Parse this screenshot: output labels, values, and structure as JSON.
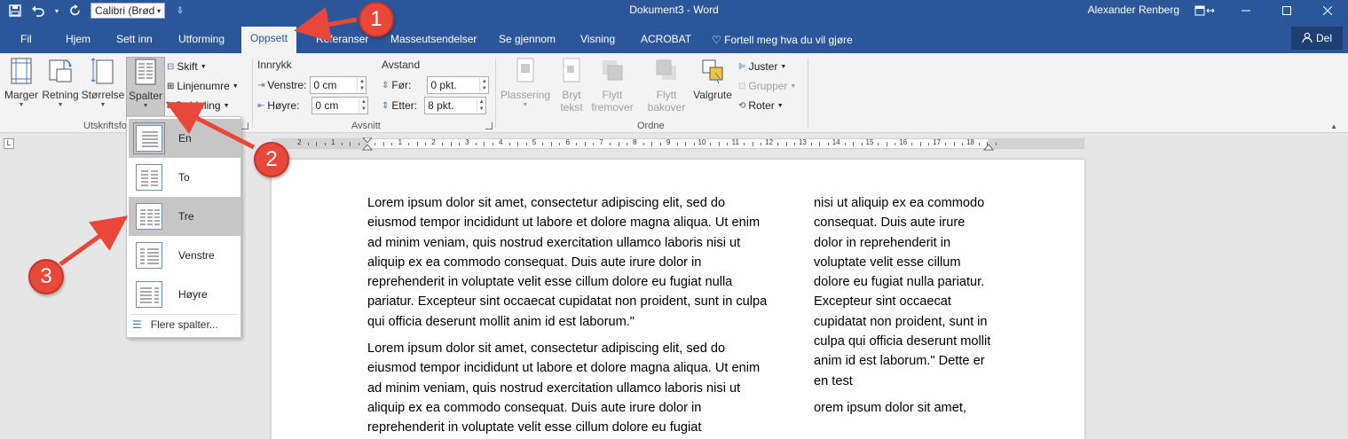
{
  "titlebar": {
    "font_name": "Calibri (Brød",
    "doc_title": "Dokument3 - Word",
    "user": "Alexander Renberg"
  },
  "tabs": [
    {
      "label": "Fil"
    },
    {
      "label": "Hjem"
    },
    {
      "label": "Sett inn"
    },
    {
      "label": "Utforming"
    },
    {
      "label": "Oppsett",
      "active": true
    },
    {
      "label": "Referanser"
    },
    {
      "label": "Masseutsendelser"
    },
    {
      "label": "Se gjennom"
    },
    {
      "label": "Visning"
    },
    {
      "label": "ACROBAT"
    }
  ],
  "tell_me": "Fortell meg hva du vil gjøre",
  "share": "Del",
  "ribbon": {
    "page_setup": {
      "margins": "Marger",
      "orientation": "Retning",
      "size": "Størrelse",
      "columns": "Spalter",
      "breaks": "Skift",
      "line_numbers": "Linjenumre",
      "hyphenation": "Orddeling",
      "group_label": "Utskriftsformat"
    },
    "paragraph": {
      "indent_head": "Innrykk",
      "spacing_head": "Avstand",
      "left_label": "Venstre:",
      "left_value": "0 cm",
      "right_label": "Høyre:",
      "right_value": "0 cm",
      "before_label": "Før:",
      "before_value": "0 pkt.",
      "after_label": "Etter:",
      "after_value": "8 pkt.",
      "group_label": "Avsnitt"
    },
    "arrange": {
      "position": "Plassering",
      "wrap_text_1": "Bryt",
      "wrap_text_2": "tekst",
      "bring_forward_1": "Flytt",
      "bring_forward_2": "fremover",
      "send_backward_1": "Flytt",
      "send_backward_2": "bakover",
      "selection_pane": "Valgrute",
      "align": "Juster",
      "group": "Grupper",
      "rotate": "Roter",
      "group_label": "Ordne"
    }
  },
  "ruler": {
    "corner": "L",
    "numbers": [
      "2",
      "1",
      "1",
      "2",
      "3",
      "4",
      "5",
      "6",
      "7",
      "8",
      "9",
      "10",
      "11",
      "12",
      "13",
      "14",
      "15",
      "16",
      "17",
      "18"
    ]
  },
  "columns_menu": {
    "items": [
      {
        "label": "En"
      },
      {
        "label": "To"
      },
      {
        "label": "Tre"
      },
      {
        "label": "Venstre"
      },
      {
        "label": "Høyre"
      }
    ],
    "more": "Flere spalter..."
  },
  "document": {
    "col1_p1": "Lorem ipsum dolor sit amet, consectetur adipiscing elit, sed do eiusmod tempor incididunt ut labore et dolore magna aliqua. Ut enim ad minim veniam, quis nostrud exercitation ullamco laboris nisi ut aliquip ex ea commodo consequat. Duis aute irure dolor in reprehenderit in voluptate velit esse cillum dolore eu fugiat nulla pariatur. Excepteur sint occaecat cupidatat non proident, sunt in culpa qui officia deserunt mollit anim id est laborum.\"",
    "col1_p2": "Lorem ipsum dolor sit amet, consectetur adipiscing elit, sed do eiusmod tempor incididunt ut labore et dolore magna aliqua. Ut enim ad minim veniam, quis nostrud exercitation ullamco laboris nisi ut aliquip ex ea commodo consequat. Duis aute irure dolor in reprehenderit in voluptate velit esse cillum dolore eu fugiat",
    "col2_p1": "nisi ut aliquip ex ea commodo consequat. Duis aute irure dolor in reprehenderit in voluptate velit esse cillum dolore eu fugiat nulla pariatur. Excepteur sint occaecat cupidatat non proident, sunt in culpa qui officia deserunt mollit anim id est laborum.\" Dette er en test",
    "col2_p2": "orem ipsum dolor sit amet,"
  },
  "callouts": [
    "1",
    "2",
    "3"
  ],
  "colors": {
    "word_blue": "#2b579a",
    "callout_red": "#e8473a"
  }
}
